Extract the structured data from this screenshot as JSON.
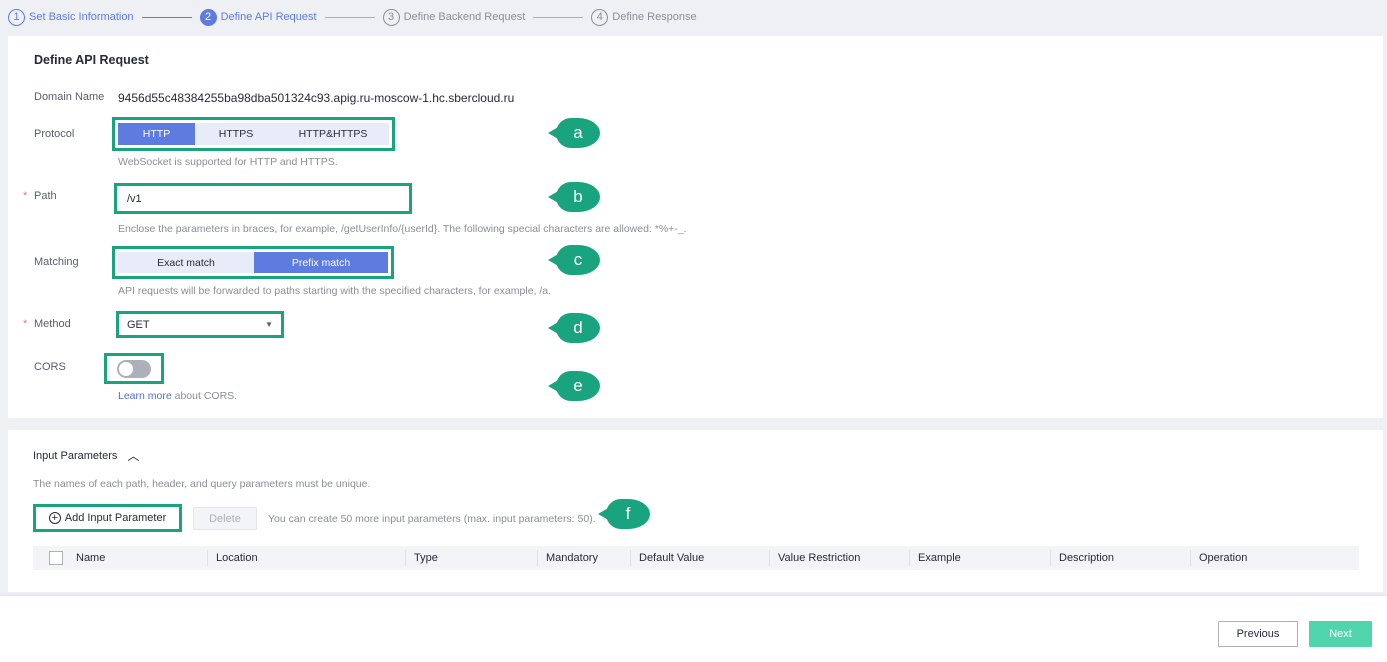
{
  "steps": [
    {
      "num": "1",
      "label": "Set Basic Information",
      "state": "done"
    },
    {
      "num": "2",
      "label": "Define API Request",
      "state": "active"
    },
    {
      "num": "3",
      "label": "Define Backend Request",
      "state": "todo"
    },
    {
      "num": "4",
      "label": "Define Response",
      "state": "todo"
    }
  ],
  "form": {
    "title": "Define API Request",
    "domain_label": "Domain Name",
    "domain_value": "9456d55c48384255ba98dba501324c93.apig.ru-moscow-1.hc.sbercloud.ru",
    "protocol_label": "Protocol",
    "protocol_options": [
      "HTTP",
      "HTTPS",
      "HTTP&HTTPS"
    ],
    "protocol_selected": "HTTP",
    "protocol_hint": "WebSocket is supported for HTTP and HTTPS.",
    "path_label": "Path",
    "path_value": "/v1",
    "path_hint": "Enclose the parameters in braces, for example, /getUserInfo/{userId}. The following special characters are allowed: *%+-_.",
    "matching_label": "Matching",
    "matching_options": [
      "Exact match",
      "Prefix match"
    ],
    "matching_selected": "Prefix match",
    "matching_hint": "API requests will be forwarded to paths starting with the specified characters, for example, /a.",
    "method_label": "Method",
    "method_value": "GET",
    "cors_label": "CORS",
    "cors_enabled": false,
    "cors_link": "Learn more",
    "cors_hint": " about CORS."
  },
  "callouts": [
    "a",
    "b",
    "c",
    "d",
    "e",
    "f"
  ],
  "callout_color": "#1aa37f",
  "accent": "#5e7ce0",
  "params": {
    "title": "Input Parameters",
    "hint": "The names of each path, header, and query parameters must be unique.",
    "add_label": "Add Input Parameter",
    "delete_label": "Delete",
    "quota": "You can create 50 more input parameters (max. input parameters: 50).",
    "columns": [
      "Name",
      "Location",
      "Type",
      "Mandatory",
      "Default Value",
      "Value Restriction",
      "Example",
      "Description",
      "Operation"
    ]
  },
  "footer": {
    "previous": "Previous",
    "next": "Next"
  }
}
